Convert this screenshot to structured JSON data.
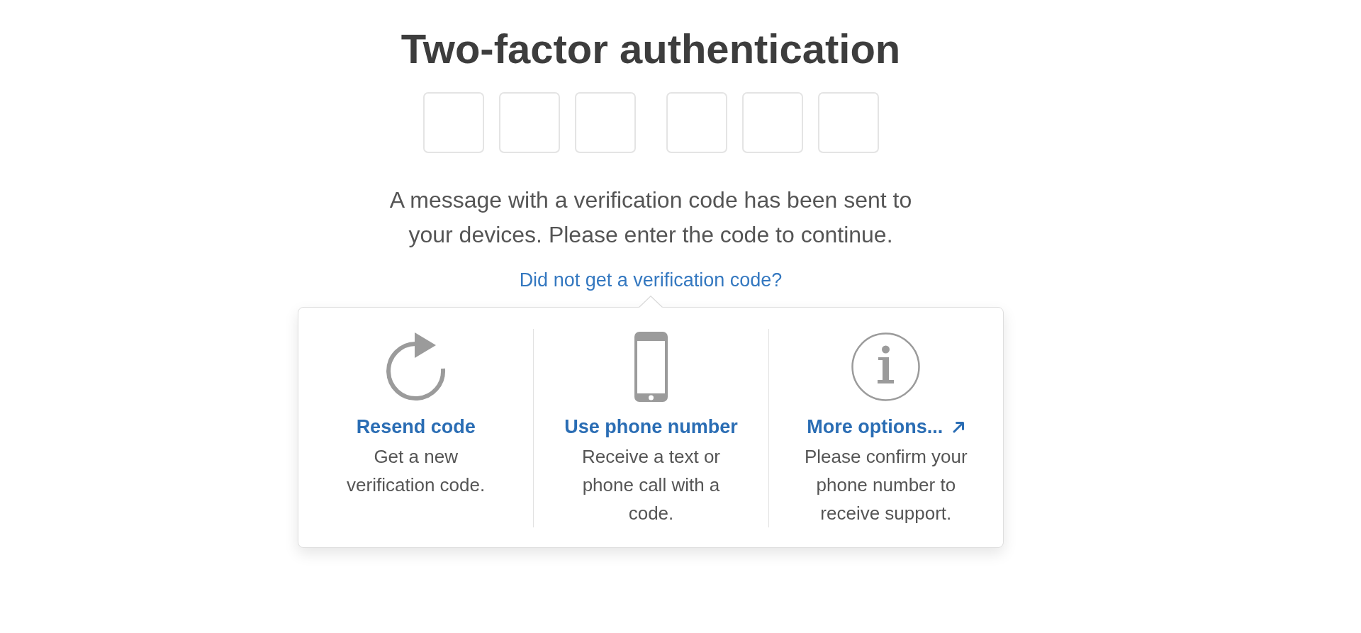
{
  "title": "Two-factor authentication",
  "code_field_groups": [
    {
      "fields": [
        {
          "focused": false
        },
        {
          "focused": false
        },
        {
          "focused": false
        }
      ]
    },
    {
      "fields": [
        {
          "focused": false
        },
        {
          "focused": false
        },
        {
          "focused": false
        }
      ]
    }
  ],
  "message": "A message with a verification code has been sent to your devices. Please enter the code to continue.",
  "help": {
    "link": "Did not get a verification code?",
    "expanded": true,
    "options": [
      {
        "kind": "resend",
        "title": "Resend code",
        "description": "Get a new verification code.",
        "external": false
      },
      {
        "kind": "phone",
        "title": "Use phone number",
        "description": "Receive a text or phone call with a code.",
        "external": false
      },
      {
        "kind": "more",
        "title": "More options...",
        "description": "Please confirm your phone number to receive support.",
        "external": true
      }
    ]
  }
}
